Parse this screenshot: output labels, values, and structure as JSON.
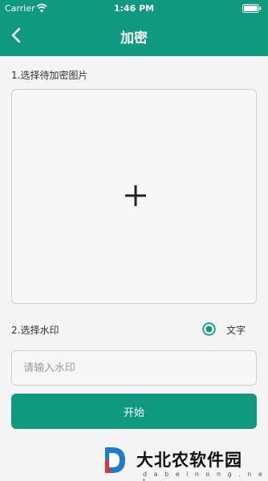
{
  "status_bar": {
    "carrier": "Carrier",
    "time": "1:46 PM"
  },
  "nav": {
    "title": "加密",
    "back_icon": "chevron-left-icon"
  },
  "step1": {
    "label": "1.选择待加密图片",
    "add_icon": "plus-icon"
  },
  "step2": {
    "label": "2.选择水印",
    "option_label": "文字",
    "option_selected": true
  },
  "watermark_input": {
    "placeholder": "请输入水印",
    "value": ""
  },
  "start_button": {
    "label": "开始"
  },
  "site_watermark": {
    "name": "大北农软件园",
    "url": "d a b e i n o n g . n e t"
  },
  "colors": {
    "accent": "#0f9a80",
    "background": "#f4f4f4"
  }
}
